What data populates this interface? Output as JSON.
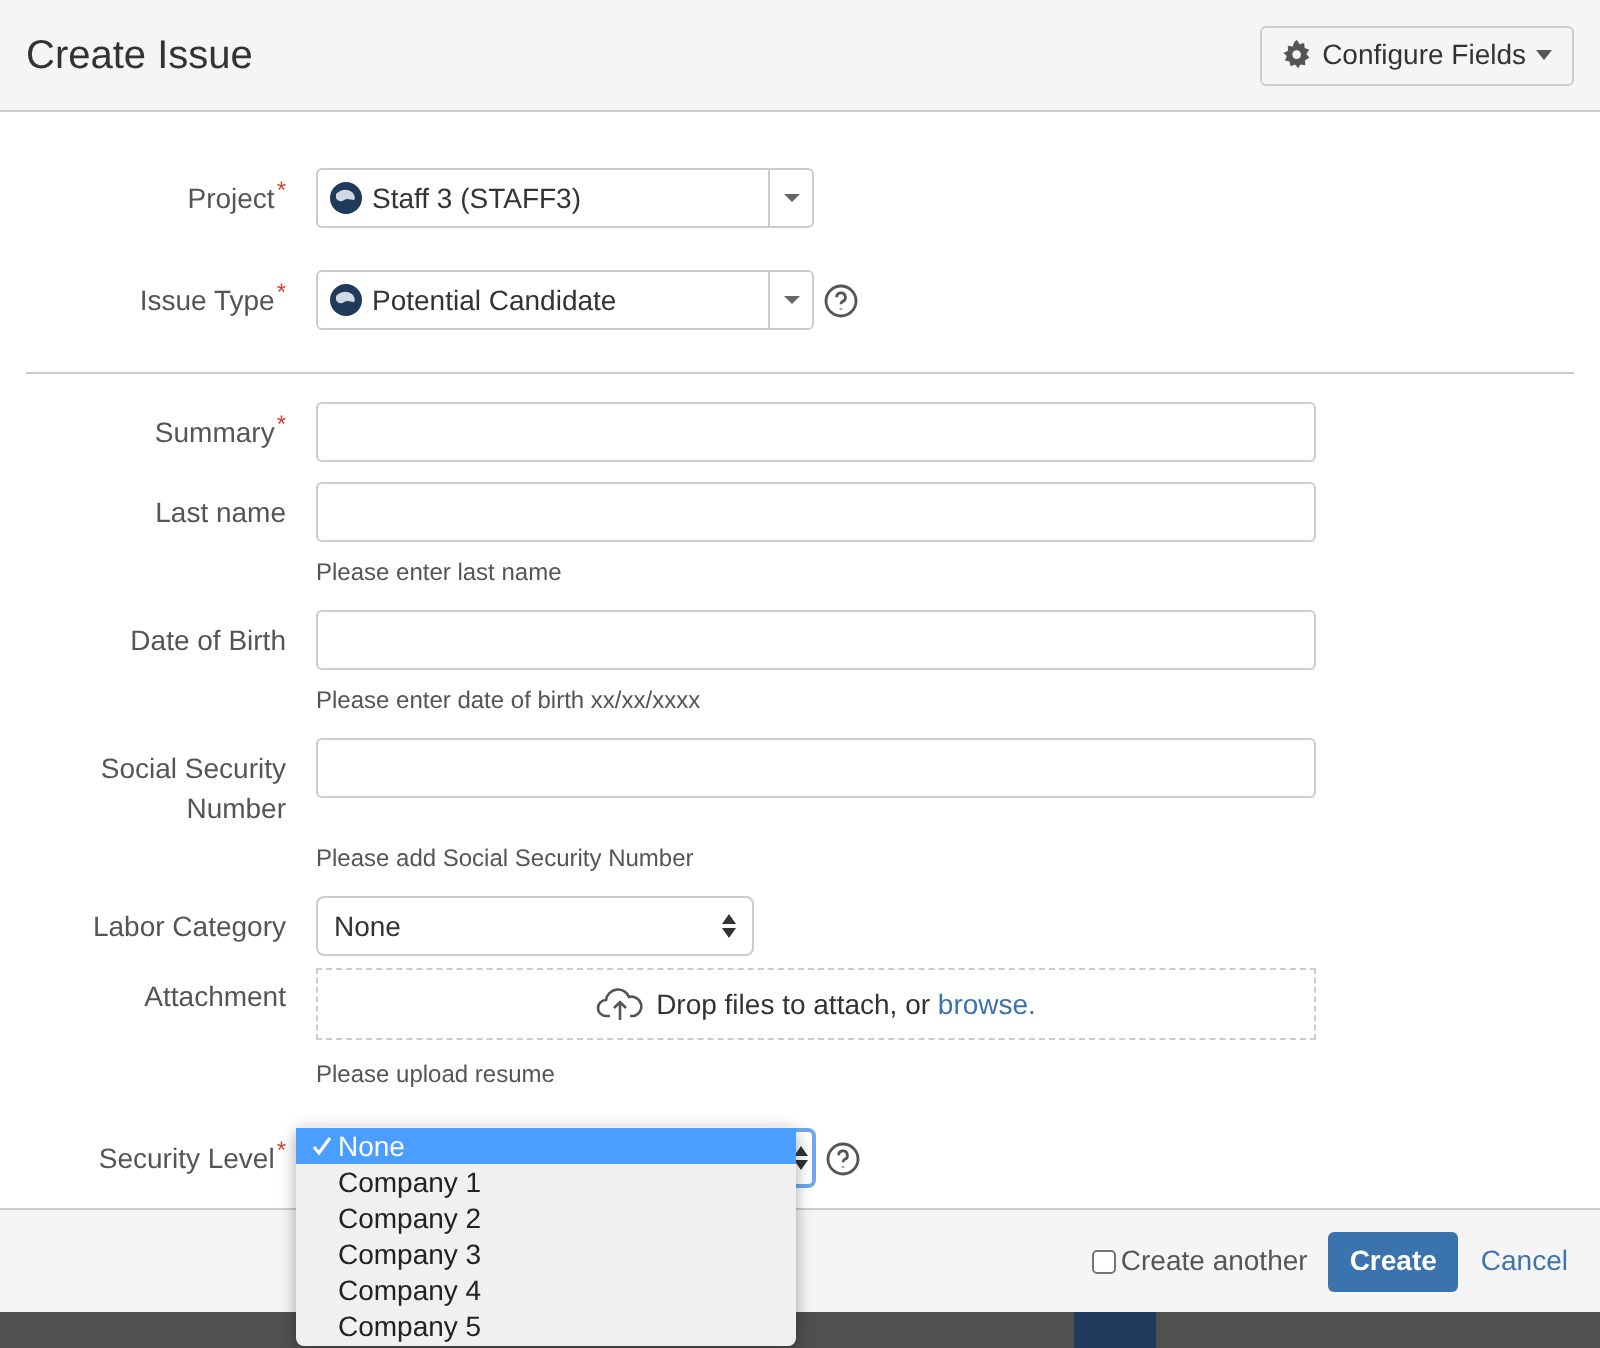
{
  "dialog": {
    "title": "Create Issue",
    "configure_button": "Configure Fields"
  },
  "top_fields": [
    {
      "label": "Project",
      "required_mark": "*",
      "value": "Staff 3 (STAFF3)"
    },
    {
      "label": "Issue Type",
      "required_mark": "*",
      "value": "Potential Candidate",
      "help": true
    }
  ],
  "fields": [
    {
      "kind": "text",
      "label_lines": [
        "Summary"
      ],
      "required_mark": "*"
    },
    {
      "kind": "text",
      "label_lines": [
        "Last name"
      ],
      "hint": "Please enter last name"
    },
    {
      "kind": "text",
      "label_lines": [
        "Date of Birth"
      ],
      "hint": "Please enter date of birth xx/xx/xxxx"
    },
    {
      "kind": "text",
      "label_lines": [
        "Social Security",
        "Number"
      ],
      "hint": "Please add Social Security Number"
    },
    {
      "kind": "select",
      "label_lines": [
        "Labor Category"
      ],
      "value": "None"
    },
    {
      "kind": "attachment",
      "label_lines": [
        "Attachment"
      ],
      "text": "Drop files to attach, or",
      "link": "browse.",
      "hint": "Please upload resume"
    },
    {
      "kind": "security",
      "label_lines": [
        "Security Level"
      ],
      "required_mark": "*",
      "help": true,
      "options": [
        {
          "label": "None",
          "selected": true
        },
        {
          "label": "Company 1",
          "selected": false
        },
        {
          "label": "Company 2",
          "selected": false
        },
        {
          "label": "Company 3",
          "selected": false
        },
        {
          "label": "Company 4",
          "selected": false
        },
        {
          "label": "Company 5",
          "selected": false
        }
      ]
    }
  ],
  "footer": {
    "create_another": {
      "label": "Create another",
      "checked": false
    },
    "create": "Create",
    "cancel": "Cancel"
  }
}
